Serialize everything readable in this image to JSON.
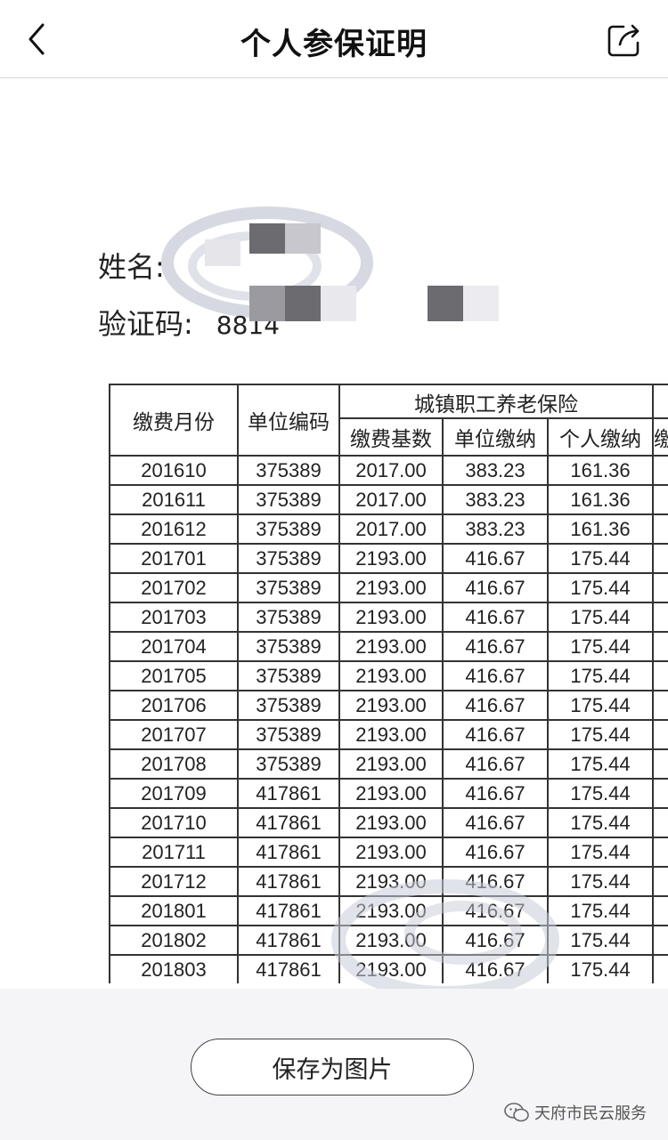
{
  "nav": {
    "title": "个人参保证明",
    "back_icon": "chevron-left-icon",
    "share_icon": "share-icon"
  },
  "info": {
    "name_label": "姓名:",
    "code_label": "验证码:",
    "code_value": "8814"
  },
  "table": {
    "header": {
      "month": "缴费月份",
      "unit_code": "单位编码",
      "group": "城镇职工养老保险",
      "base": "缴费基数",
      "unit_pay": "单位缴纳",
      "personal_pay": "个人缴纳",
      "next": "缴"
    },
    "rows": [
      [
        "201610",
        "375389",
        "2017.00",
        "383.23",
        "161.36"
      ],
      [
        "201611",
        "375389",
        "2017.00",
        "383.23",
        "161.36"
      ],
      [
        "201612",
        "375389",
        "2017.00",
        "383.23",
        "161.36"
      ],
      [
        "201701",
        "375389",
        "2193.00",
        "416.67",
        "175.44"
      ],
      [
        "201702",
        "375389",
        "2193.00",
        "416.67",
        "175.44"
      ],
      [
        "201703",
        "375389",
        "2193.00",
        "416.67",
        "175.44"
      ],
      [
        "201704",
        "375389",
        "2193.00",
        "416.67",
        "175.44"
      ],
      [
        "201705",
        "375389",
        "2193.00",
        "416.67",
        "175.44"
      ],
      [
        "201706",
        "375389",
        "2193.00",
        "416.67",
        "175.44"
      ],
      [
        "201707",
        "375389",
        "2193.00",
        "416.67",
        "175.44"
      ],
      [
        "201708",
        "375389",
        "2193.00",
        "416.67",
        "175.44"
      ],
      [
        "201709",
        "417861",
        "2193.00",
        "416.67",
        "175.44"
      ],
      [
        "201710",
        "417861",
        "2193.00",
        "416.67",
        "175.44"
      ],
      [
        "201711",
        "417861",
        "2193.00",
        "416.67",
        "175.44"
      ],
      [
        "201712",
        "417861",
        "2193.00",
        "416.67",
        "175.44"
      ],
      [
        "201801",
        "417861",
        "2193.00",
        "416.67",
        "175.44"
      ],
      [
        "201802",
        "417861",
        "2193.00",
        "416.67",
        "175.44"
      ],
      [
        "201803",
        "417861",
        "2193.00",
        "416.67",
        "175.44"
      ]
    ]
  },
  "bottom": {
    "save_label": "保存为图片",
    "brand": "天府市民云服务",
    "brand_icon": "wechat-icon"
  },
  "colors": {
    "border": "#333333",
    "bottom_bg": "#f5f5f7",
    "watermark": "#c8ccd8"
  }
}
